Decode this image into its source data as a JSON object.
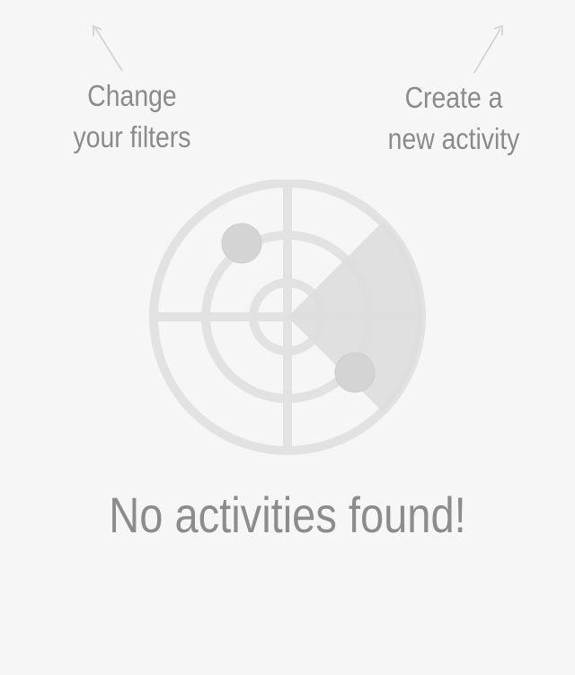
{
  "hints": {
    "filters": {
      "line1": "Change",
      "line2": "your filters",
      "icon": "arrow-up-left-icon"
    },
    "create": {
      "line1": "Create a",
      "line2": "new activity",
      "icon": "arrow-up-right-icon"
    }
  },
  "empty_state": {
    "title": "No activities found!",
    "illustration": "radar-icon"
  },
  "colors": {
    "background": "#f6f6f6",
    "text": "#8a8a8a",
    "radar": "#e2e2e2",
    "radar_sweep": "#dedede",
    "radar_blip": "#d4d4d4"
  }
}
